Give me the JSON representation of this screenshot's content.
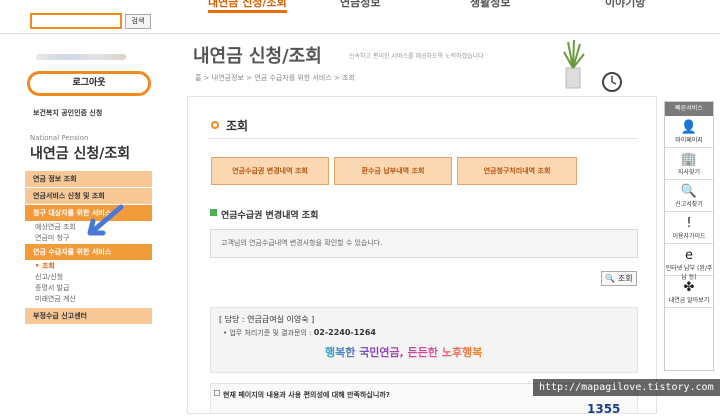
{
  "topbar": {
    "search_button": "검색",
    "gnb": [
      "내연금 신청/조회",
      "연금정보",
      "생활정보",
      "이야기방"
    ]
  },
  "left": {
    "logout": "로그아웃",
    "cert_link": "보건복지 공인인증 신청",
    "np_label": "National Pension",
    "title": "내연금 신청/조회",
    "menu": {
      "m1": "연금 정보 조회",
      "m2": "연금서비스 신청 및 조회",
      "m3": "청구 대상자를 위한 서비스",
      "m3_subs": [
        "예상연금 조회",
        "연금미 청구"
      ],
      "m4": "연금 수급자를 위한 서비스",
      "m4_subs": [
        "조회",
        "신고/신청",
        "증명서 발급",
        "미래연금 계산"
      ],
      "m5": "부정수급 신고센터"
    }
  },
  "header": {
    "title": "내연금 신청/조회",
    "desc": "신속하고 편리한 서비스를 제공하도록 노력하겠습니다",
    "breadcrumb": "홈 > 내연금정보 > 연금 수급자를 위한 서비스 > 조회"
  },
  "content": {
    "section_title": "조회",
    "tabs": [
      "연금수급권 변경내역 조회",
      "환수금 납부내역 조회",
      "연금청구처리내역 조회"
    ],
    "sub_title": "연금수급권 변경내역 조회",
    "info_text": "고객님의 연금수급내역 변경사항을 확인할 수 있습니다.",
    "view_button": "조회",
    "contact": {
      "line1": "[ 담당 : 연금급여실 이영숙 ]",
      "line2": "• 업무 처리기준 및 결과문의 :",
      "phone": "02-2240-1264"
    },
    "slogan": "행복한 국민연금, 든든한 노후행복",
    "survey_question": "현재 페이지의 내용과 사용 편의성에 대해 만족하십니까?",
    "callcenter": "1355"
  },
  "quick": {
    "header": "빠른서비스",
    "items": [
      "마이페이지",
      "지사찾기",
      "신고서찾기",
      "이용자가이드",
      "인터넷 납부 (완/주납 등)",
      "내연금 알아보기"
    ],
    "icons": [
      "person-icon",
      "building-icon",
      "magnifier-doc-icon",
      "exclamation-icon",
      "e-icon",
      "clover-icon"
    ]
  },
  "watermark": "http://mapagilove.tistory.com",
  "colors": {
    "accent": "#f08a1f",
    "tab_bg": "#fbd8b2",
    "menu_light": "#f7c896",
    "menu_dark": "#f39a3a"
  }
}
